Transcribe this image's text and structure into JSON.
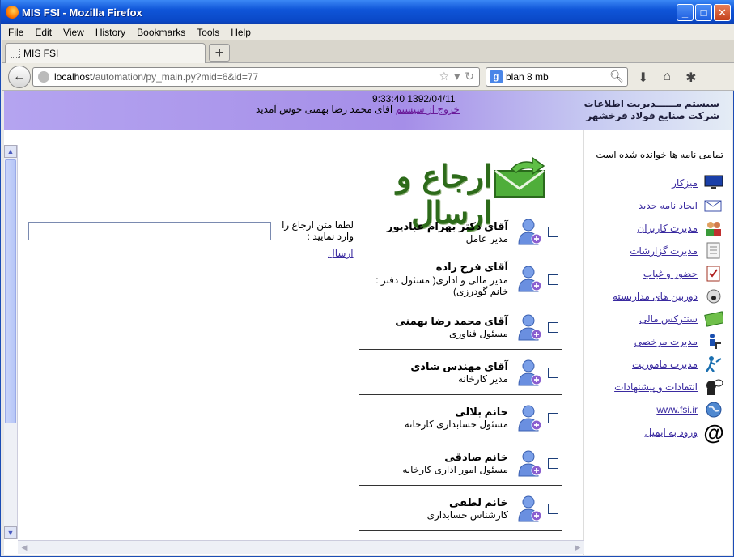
{
  "window": {
    "title": "MIS FSI - Mozilla Firefox"
  },
  "menubar": [
    "File",
    "Edit",
    "View",
    "History",
    "Bookmarks",
    "Tools",
    "Help"
  ],
  "tab": {
    "label": "MIS FSI"
  },
  "urlbar": {
    "host": "localhost",
    "path": "/automation/py_main.py?mid=6&id=77"
  },
  "search": {
    "value": "blan 8 mb"
  },
  "header": {
    "logo_line1": "سیستم مــــــدیریت اطلاعات",
    "logo_line2": "شرکت صنایع فولاد فرخشهر",
    "datetime": "9:33:40 1392/04/11",
    "welcome": "آقای محمد رضا بهمنی خوش آمدید",
    "logout": "خروج از سیستم"
  },
  "sidebar": {
    "note": "تمامی نامه ها خوانده شده است",
    "items": [
      {
        "label": "میزکار",
        "icon": "monitor-icon"
      },
      {
        "label": "ایجاد نامه جدید",
        "icon": "new-mail-icon"
      },
      {
        "label": "مدیرت کاربران",
        "icon": "users-icon"
      },
      {
        "label": "مدیرت گزارشات",
        "icon": "report-icon"
      },
      {
        "label": "حضور و غیاب",
        "icon": "attendance-icon"
      },
      {
        "label": "دوربین های مداربسته",
        "icon": "camera-icon"
      },
      {
        "label": "سنترکس مالی",
        "icon": "money-icon"
      },
      {
        "label": "مدیرت مرخصی",
        "icon": "leave-icon"
      },
      {
        "label": "مدیرت ماموریت",
        "icon": "mission-icon"
      },
      {
        "label": "انتقادات و پیشنهادات",
        "icon": "feedback-icon"
      },
      {
        "label": "www.fsi.ir",
        "icon": "globe-icon"
      },
      {
        "label": "ورود به ایمیل",
        "icon": "at-icon"
      }
    ]
  },
  "banner": {
    "title": "ارجاع و ارسال"
  },
  "form": {
    "label": "لطفا متن ارجاع را وارد نمایید :",
    "input_value": "",
    "send": "ارسال"
  },
  "recipients": [
    {
      "name": "آقای دکتر بهرام عبادپور",
      "role": "مدیر عامل"
    },
    {
      "name": "آقای فرج زاده",
      "role": "مدیر مالی و اداری( مسئول دفتر : خانم گودرزی)"
    },
    {
      "name": "آقای محمد رضا بهمنی",
      "role": "مسئول فناوری"
    },
    {
      "name": "آقای مهندس شادی",
      "role": "مدیر کارخانه"
    },
    {
      "name": "خانم بلالی",
      "role": "مسئول حسابداری کارخانه"
    },
    {
      "name": "خانم صادقی",
      "role": "مسئول امور اداری کارخانه"
    },
    {
      "name": "خانم لطفی",
      "role": "کارشناس حسابداری"
    }
  ]
}
